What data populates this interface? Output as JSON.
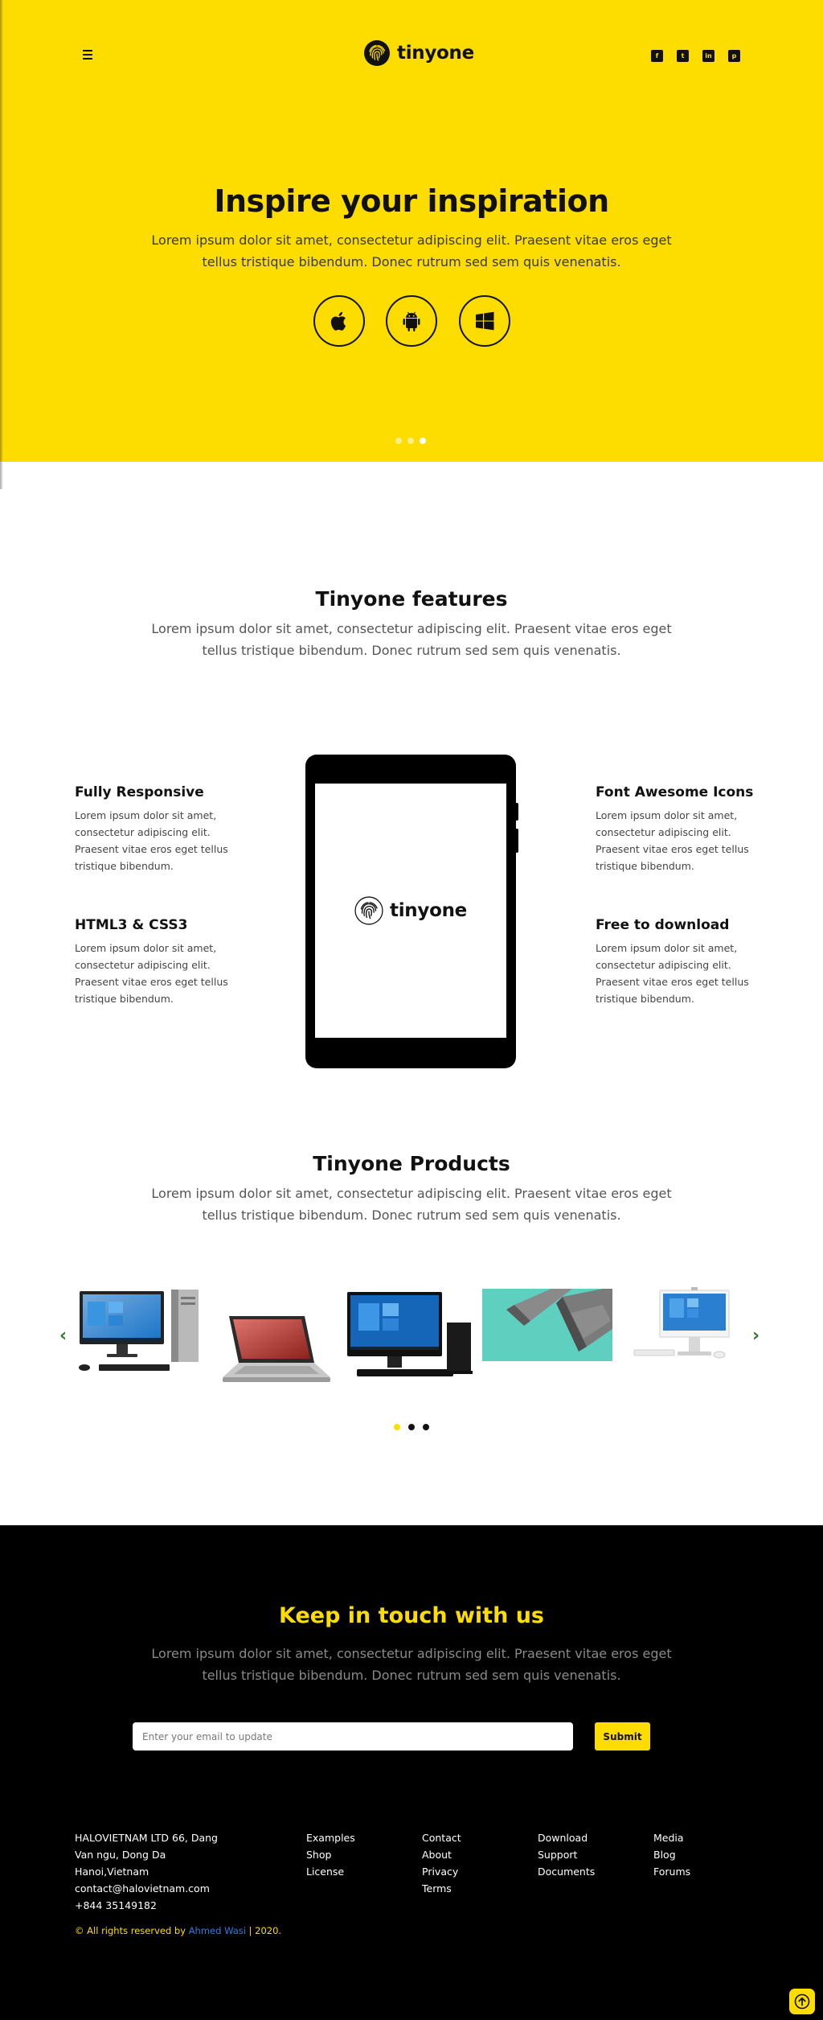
{
  "brand": {
    "name": "tinyone",
    "accent": "#fddd00",
    "link_color": "#2f7de1"
  },
  "header": {
    "menu_icon": "hamburger-icon",
    "social": [
      {
        "name": "facebook",
        "icon": "facebook-square-icon"
      },
      {
        "name": "twitter",
        "icon": "twitter-square-icon"
      },
      {
        "name": "linkedin",
        "icon": "linkedin-icon"
      },
      {
        "name": "pinterest",
        "icon": "pinterest-square-icon"
      }
    ]
  },
  "hero": {
    "title": "Inspire your inspiration",
    "subtitle": "Lorem ipsum dolor sit amet, consectetur adipiscing elit. Praesent vitae eros eget tellus tristique bibendum. Donec rutrum sed sem quis venenatis.",
    "platforms": [
      {
        "name": "apple",
        "icon": "apple-icon"
      },
      {
        "name": "android",
        "icon": "android-icon"
      },
      {
        "name": "windows",
        "icon": "windows-icon"
      }
    ],
    "slide_count": 3,
    "active_slide": 3
  },
  "features": {
    "title": "Tinyone features",
    "subtitle": "Lorem ipsum dolor sit amet, consectetur adipiscing elit. Praesent vitae eros eget tellus tristique bibendum. Donec rutrum sed sem quis venenatis.",
    "items": [
      {
        "title": "Fully Responsive",
        "text": "Lorem ipsum dolor sit amet, consectetur adipiscing elit. Praesent vitae eros eget tellus tristique bibendum."
      },
      {
        "title": "HTML3 & CSS3",
        "text": "Lorem ipsum dolor sit amet, consectetur adipiscing elit. Praesent vitae eros eget tellus tristique bibendum."
      },
      {
        "title": "Font Awesome Icons",
        "text": "Lorem ipsum dolor sit amet, consectetur adipiscing elit. Praesent vitae eros eget tellus tristique bibendum."
      },
      {
        "title": "Free to download",
        "text": "Lorem ipsum dolor sit amet, consectetur adipiscing elit. Praesent vitae eros eget tellus tristique bibendum."
      }
    ]
  },
  "products": {
    "title": "Tinyone Products",
    "subtitle": "Lorem ipsum dolor sit amet, consectetur adipiscing elit. Praesent vitae eros eget tellus tristique bibendum. Donec rutrum sed sem quis venenatis.",
    "prev_icon": "chevron-left-icon",
    "next_icon": "chevron-right-icon",
    "items": [
      {
        "name": "desktop-pc-with-monitor"
      },
      {
        "name": "open-laptop"
      },
      {
        "name": "desktop-monitor-and-tower"
      },
      {
        "name": "folded-laptops"
      },
      {
        "name": "all-in-one-pc"
      }
    ],
    "dot_count": 3,
    "active_dot": 1
  },
  "footer": {
    "title": "Keep in touch with us",
    "subtitle": "Lorem ipsum dolor sit amet, consectetur adipiscing elit. Praesent vitae eros eget tellus tristique bibendum. Donec rutrum sed sem quis venenatis.",
    "email_placeholder": "Enter your email to update",
    "email_value": "",
    "submit_label": "Submit",
    "address": {
      "line1": "HALOVIETNAM LTD 66, Dang",
      "line2": "Van ngu, Dong Da",
      "line3": "Hanoi,Vietnam",
      "email": "contact@halovietnam.com",
      "phone": "+844 35149182"
    },
    "link_columns": [
      [
        "Examples",
        "Shop",
        "License"
      ],
      [
        "Contact",
        "About",
        "Privacy",
        "Terms"
      ],
      [
        "Download",
        "Support",
        "Documents"
      ],
      [
        "Media",
        "Blog",
        "Forums"
      ]
    ],
    "copyright": {
      "prefix": "© All rights reserved by",
      "author": "Ahmed Wasi",
      "suffix": "| 2020."
    },
    "to_top_icon": "arrow-up-icon"
  }
}
